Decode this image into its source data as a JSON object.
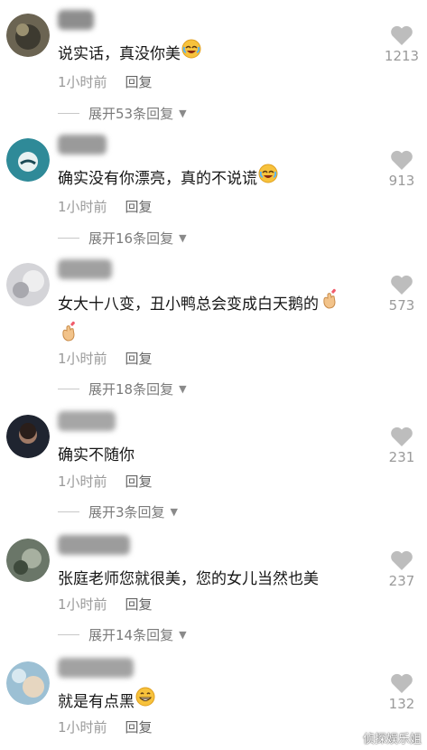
{
  "comments": [
    {
      "avatar_color": "#5a5545",
      "text": "说实话，真没你美",
      "emoji": "rofl-emoji",
      "time": "1小时前",
      "reply": "回复",
      "expand": "展开53条回复",
      "likes": "1213"
    },
    {
      "avatar_color": "#3a7b8a",
      "text": "确实没有你漂亮，真的不说谎",
      "emoji": "rofl-emoji",
      "time": "1小时前",
      "reply": "回复",
      "expand": "展开16条回复",
      "likes": "913"
    },
    {
      "avatar_color": "#c8c8cc",
      "text": "女大十八变，丑小鸭总会变成白天鹅的",
      "emoji": "finger-heart-emoji",
      "time": "1小时前",
      "reply": "回复",
      "expand": "展开18条回复",
      "likes": "573"
    },
    {
      "avatar_color": "#2a2e3a",
      "text": "确实不随你",
      "time": "1小时前",
      "reply": "回复",
      "expand": "展开3条回复",
      "likes": "231"
    },
    {
      "avatar_color": "#5e6a5c",
      "text": "张庭老师您就很美，您的女儿当然也美",
      "time": "1小时前",
      "reply": "回复",
      "expand": "展开14条回复",
      "likes": "237"
    },
    {
      "avatar_color": "#8ab2c8",
      "text": "就是有点黑",
      "emoji": "grin-emoji",
      "time": "1小时前",
      "reply": "回复",
      "likes": "132"
    }
  ],
  "icons": {
    "like": "heart-icon",
    "expand": "caret-down-icon"
  },
  "watermark": "侦探娱乐姐"
}
